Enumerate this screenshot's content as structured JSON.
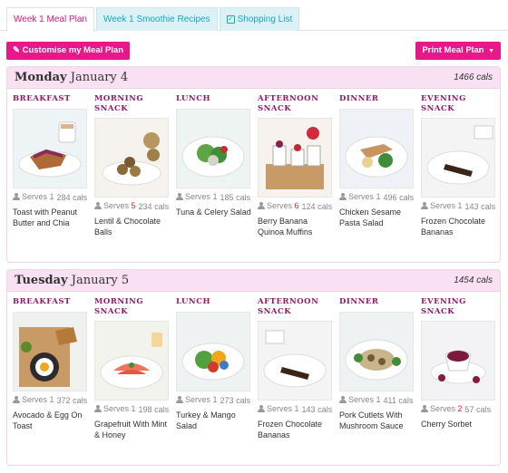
{
  "tabs": [
    {
      "label": "Week 1 Meal Plan",
      "active": true
    },
    {
      "label": "Week 1 Smoothie Recipes",
      "active": false
    },
    {
      "label": "Shopping List",
      "active": false,
      "icon": "checkbox-icon"
    }
  ],
  "actions": {
    "customise_label": "Customise my Meal Plan",
    "print_label": "Print Meal Plan"
  },
  "colors": {
    "accent": "#e8178a",
    "tab_text": "#17a7c4",
    "label_purple": "#8e1b6b",
    "header_bg": "#f9e1f3"
  },
  "days": [
    {
      "weekday": "Monday",
      "date": "January 4",
      "total": "1466 cals",
      "meals": [
        {
          "label": "BREAKFAST",
          "serves_text": "Serves",
          "serves": "1",
          "cals": "284 cals",
          "name": "Toast with Peanut Butter and Chia"
        },
        {
          "label": "MORNING SNACK",
          "serves_text": "Serves",
          "serves": "5",
          "cals": "234 cals",
          "name": "Lentil & Chocolate Balls"
        },
        {
          "label": "LUNCH",
          "serves_text": "Serves",
          "serves": "1",
          "cals": "185 cals",
          "name": "Tuna & Celery Salad"
        },
        {
          "label": "AFTERNOON SNACK",
          "serves_text": "Serves",
          "serves": "6",
          "cals": "124 cals",
          "name": "Berry Banana Quinoa Muffins"
        },
        {
          "label": "DINNER",
          "serves_text": "Serves",
          "serves": "1",
          "cals": "496 cals",
          "name": "Chicken Sesame Pasta Salad"
        },
        {
          "label": "EVENING SNACK",
          "serves_text": "Serves",
          "serves": "1",
          "cals": "143 cals",
          "name": "Frozen Chocolate Bananas"
        }
      ]
    },
    {
      "weekday": "Tuesday",
      "date": "January 5",
      "total": "1454 cals",
      "meals": [
        {
          "label": "BREAKFAST",
          "serves_text": "Serves",
          "serves": "1",
          "cals": "372 cals",
          "name": "Avocado & Egg On Toast"
        },
        {
          "label": "MORNING SNACK",
          "serves_text": "Serves",
          "serves": "1",
          "cals": "198 cals",
          "name": "Grapefruit With Mint & Honey"
        },
        {
          "label": "LUNCH",
          "serves_text": "Serves",
          "serves": "1",
          "cals": "273 cals",
          "name": "Turkey & Mango Salad"
        },
        {
          "label": "AFTERNOON SNACK",
          "serves_text": "Serves",
          "serves": "1",
          "cals": "143 cals",
          "name": "Frozen Chocolate Bananas"
        },
        {
          "label": "DINNER",
          "serves_text": "Serves",
          "serves": "1",
          "cals": "411 cals",
          "name": "Pork Cutlets With Mushroom Sauce"
        },
        {
          "label": "EVENING SNACK",
          "serves_text": "Serves",
          "serves": "2",
          "cals": "57 cals",
          "name": "Cherry Sorbet"
        }
      ]
    }
  ]
}
